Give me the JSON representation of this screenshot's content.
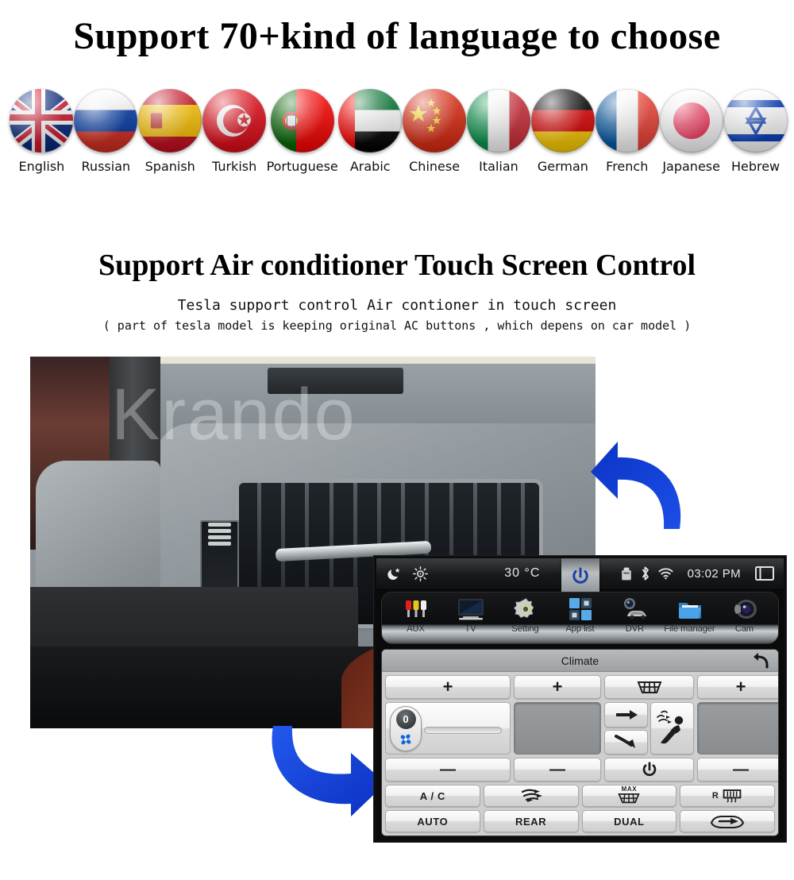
{
  "section_language": {
    "headline": "Support 70+kind of  language to choose",
    "flags": [
      {
        "label": "English",
        "code": "gb"
      },
      {
        "label": "Russian",
        "code": "ru"
      },
      {
        "label": "Spanish",
        "code": "es"
      },
      {
        "label": "Turkish",
        "code": "tr"
      },
      {
        "label": "Portuguese",
        "code": "pt"
      },
      {
        "label": "Arabic",
        "code": "ae"
      },
      {
        "label": "Chinese",
        "code": "cn"
      },
      {
        "label": "Italian",
        "code": "it"
      },
      {
        "label": "German",
        "code": "de"
      },
      {
        "label": "French",
        "code": "fr"
      },
      {
        "label": "Japanese",
        "code": "jp"
      },
      {
        "label": "Hebrew",
        "code": "il"
      }
    ]
  },
  "section_ac": {
    "headline": "Support Air conditioner Touch Screen Control",
    "subtitle_1": "Tesla support control Air contioner in touch screen",
    "subtitle_2": "( part of tesla model is keeping original AC buttons , which depens on car model )",
    "watermark": "Krando"
  },
  "head_unit": {
    "status_bar": {
      "night_icon": "moon-icon",
      "brightness_icon": "sun-brightness-icon",
      "temperature": "30  °C",
      "power_icon": "power-icon",
      "usb_icon": "usb-drive-icon",
      "bluetooth_icon": "bluetooth-icon",
      "wifi_icon": "wifi-icon",
      "time": "03:02 PM",
      "window_icon": "window-icon"
    },
    "dock": [
      {
        "label": "AUX",
        "icon": "rca-connectors-icon"
      },
      {
        "label": "TV",
        "icon": "television-icon"
      },
      {
        "label": "Setting",
        "icon": "gear-icon"
      },
      {
        "label": "App list",
        "icon": "app-grid-icon"
      },
      {
        "label": "DVR",
        "icon": "dashcam-car-icon"
      },
      {
        "label": "File manager",
        "icon": "folder-icon"
      },
      {
        "label": "Cam",
        "icon": "camera-lens-icon"
      }
    ],
    "climate": {
      "title": "Climate",
      "back_icon": "back-arrow-icon",
      "row_increment": [
        {
          "name": "driver-temp-up",
          "label": "+",
          "icon": "plus-icon"
        },
        {
          "name": "fan-speed-up",
          "label": "+",
          "icon": "plus-icon"
        },
        {
          "name": "front-defrost",
          "label": "",
          "icon": "defrost-windshield-icon"
        },
        {
          "name": "passenger-temp-up",
          "label": "+",
          "icon": "plus-icon"
        }
      ],
      "fan_slider": {
        "value": "0",
        "icon": "fan-icon"
      },
      "driver_temp_display": "",
      "mode_arrows": [
        {
          "name": "airflow-face",
          "icon": "arrow-right-icon"
        },
        {
          "name": "airflow-floor",
          "icon": "arrow-curve-down-icon"
        }
      ],
      "seat_mode": {
        "name": "airflow-face-seat",
        "icon": "seat-airflow-icon"
      },
      "passenger_temp_display": "",
      "row_decrement": [
        {
          "name": "driver-temp-down",
          "label": "—",
          "icon": "minus-icon"
        },
        {
          "name": "fan-speed-down",
          "label": "—",
          "icon": "minus-icon"
        },
        {
          "name": "climate-power",
          "label": "",
          "icon": "power-icon"
        },
        {
          "name": "passenger-temp-down",
          "label": "—",
          "icon": "minus-icon"
        }
      ],
      "row_functions": [
        {
          "name": "ac-toggle",
          "label": "A / C",
          "icon": ""
        },
        {
          "name": "front-defog",
          "label": "",
          "icon": "airflow-lines-icon"
        },
        {
          "name": "max-defrost",
          "label": "MAX",
          "icon": "max-defrost-icon"
        },
        {
          "name": "rear-defog",
          "label": "R",
          "icon": "rear-defrost-icon"
        }
      ],
      "row_modes": [
        {
          "name": "auto-mode",
          "label": "AUTO",
          "icon": ""
        },
        {
          "name": "rear-climate",
          "label": "REAR",
          "icon": ""
        },
        {
          "name": "dual-zone",
          "label": "DUAL",
          "icon": ""
        },
        {
          "name": "recirculation",
          "label": "",
          "icon": "recirculation-car-icon"
        }
      ]
    }
  },
  "annotations": {
    "arrow_top": "blue-curved-arrow-left",
    "arrow_bottom": "blue-curved-arrow-right"
  },
  "colors": {
    "accent_blue": "#1049e0",
    "watermark": "rgba(255,255,255,0.30)",
    "status_bar_bg": "#17191b"
  }
}
